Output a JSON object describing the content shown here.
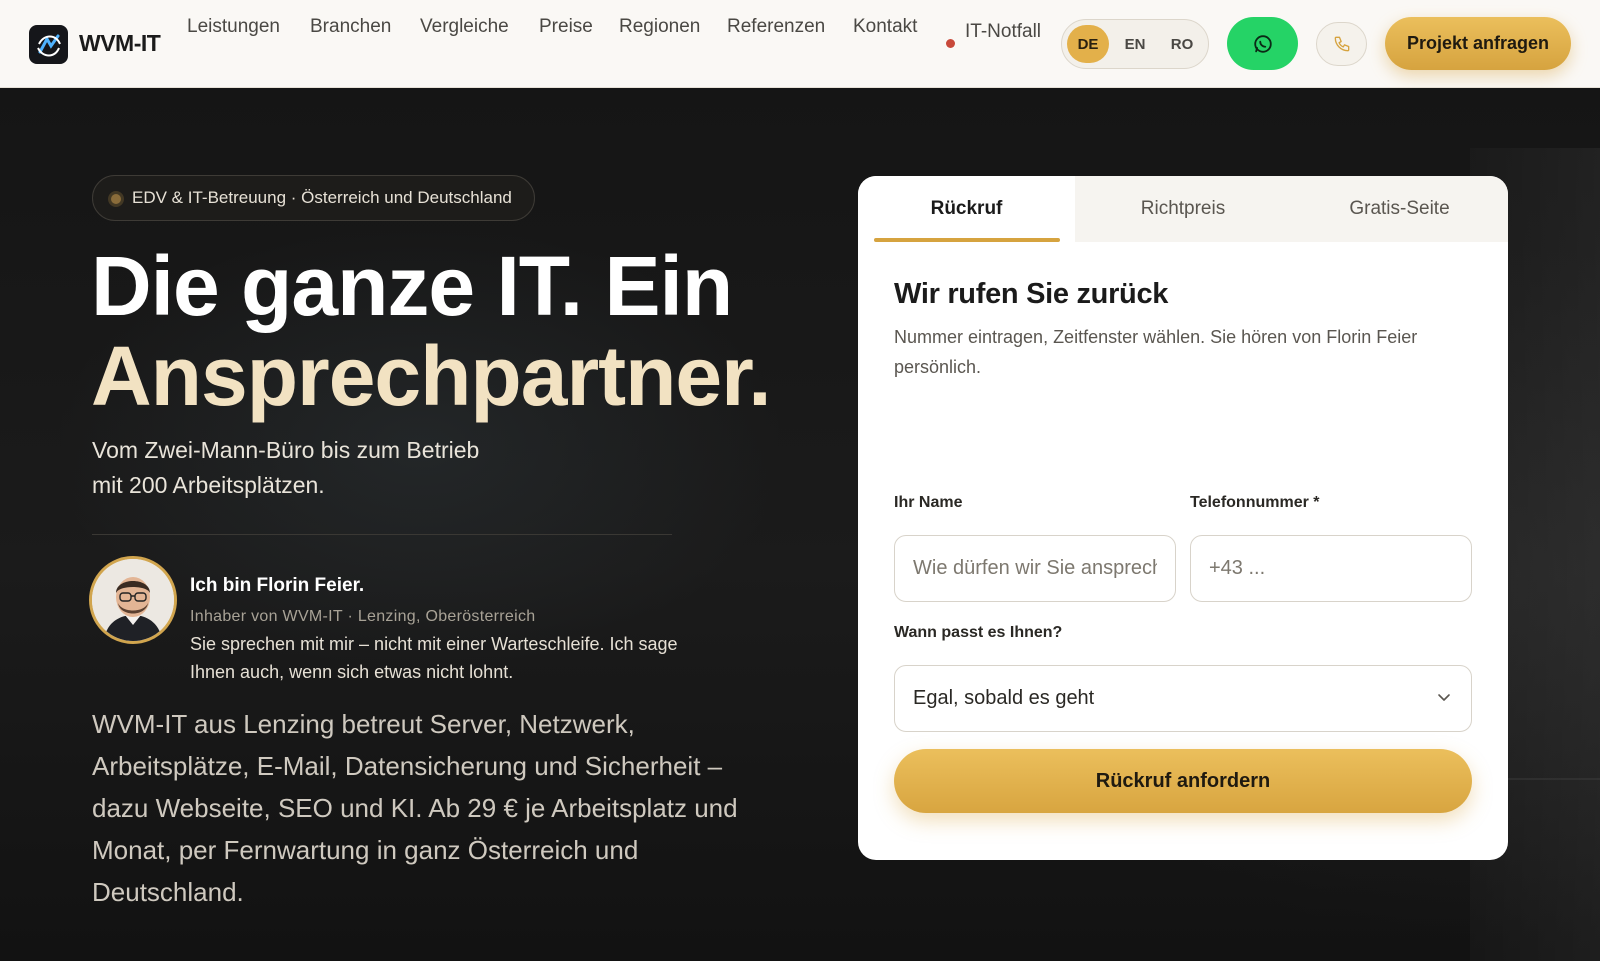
{
  "brand": {
    "name": "WVM-IT"
  },
  "nav": {
    "items": [
      "Leistungen",
      "Branchen",
      "Vergleiche",
      "Preise",
      "Regionen",
      "Referenzen",
      "Kontakt"
    ],
    "notfall": "IT-Notfall"
  },
  "lang": {
    "options": [
      "DE",
      "EN",
      "RO"
    ],
    "active": "DE"
  },
  "header": {
    "cta_label": "Projekt anfragen"
  },
  "hero": {
    "badge": "EDV & IT-Betreuung · Österreich und Deutschland",
    "headline_line1": "Die ganze IT. Ein",
    "headline_line2": "Ansprechpartner.",
    "subline": "Vom Zwei-Mann-Büro bis zum Betrieb mit 200 Arbeitsplätzen.",
    "person": {
      "name": "Ich bin Florin Feier.",
      "role": "Inhaber von WVM-IT · Lenzing, Oberösterreich",
      "quote": "Sie sprechen mit mir – nicht mit einer Warteschleife. Ich sage Ihnen auch, wenn sich etwas nicht lohnt."
    },
    "body": "WVM-IT aus Lenzing betreut Server, Netzwerk, Arbeitsplätze, E-Mail, Datensicherung und Sicherheit – dazu Webseite, SEO und KI. Ab 29 € je Arbeitsplatz und Monat, per Fernwartung in ganz Österreich und Deutschland."
  },
  "form": {
    "tabs": [
      "Rückruf",
      "Richtpreis",
      "Gratis-Seite"
    ],
    "active_tab": "Rückruf",
    "title": "Wir rufen Sie zurück",
    "description": "Nummer eintragen, Zeitfenster wählen. Sie hören von Florin Feier persönlich.",
    "name_label": "Ihr Name",
    "name_placeholder": "Wie dürfen wir Sie ansprechen?",
    "phone_label": "Telefonnummer *",
    "phone_placeholder": "+43 ...",
    "time_label": "Wann passt es Ihnen?",
    "time_value": "Egal, sobald es geht",
    "submit_label": "Rückruf anfordern"
  },
  "colors": {
    "accent": "#d6a33f",
    "whatsapp": "#25d366",
    "dark_bg": "#151515",
    "headline_cream": "#f2e2c2"
  }
}
